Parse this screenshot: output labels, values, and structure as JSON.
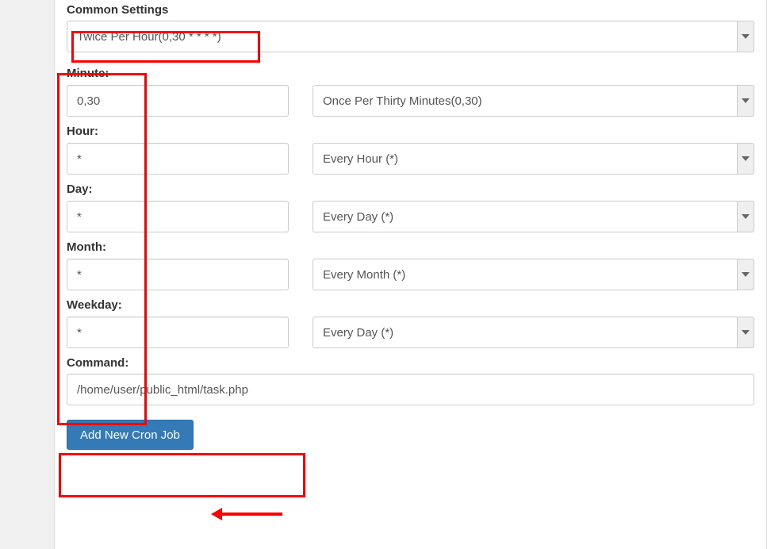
{
  "labels": {
    "common_settings": "Common Settings",
    "minute": "Minute:",
    "hour": "Hour:",
    "day": "Day:",
    "month": "Month:",
    "weekday": "Weekday:",
    "command": "Command:"
  },
  "common_settings": {
    "selected": "Twice Per Hour(0,30 * * * *)"
  },
  "minute": {
    "value": "0,30",
    "preset_selected": "Once Per Thirty Minutes(0,30)"
  },
  "hour": {
    "value": "*",
    "preset_selected": "Every Hour (*)"
  },
  "day": {
    "value": "*",
    "preset_selected": "Every Day (*)"
  },
  "month": {
    "value": "*",
    "preset_selected": "Every Month (*)"
  },
  "weekday": {
    "value": "*",
    "preset_selected": "Every Day (*)"
  },
  "command": {
    "value": "/home/user/public_html/task.php"
  },
  "submit_label": "Add New Cron Job"
}
